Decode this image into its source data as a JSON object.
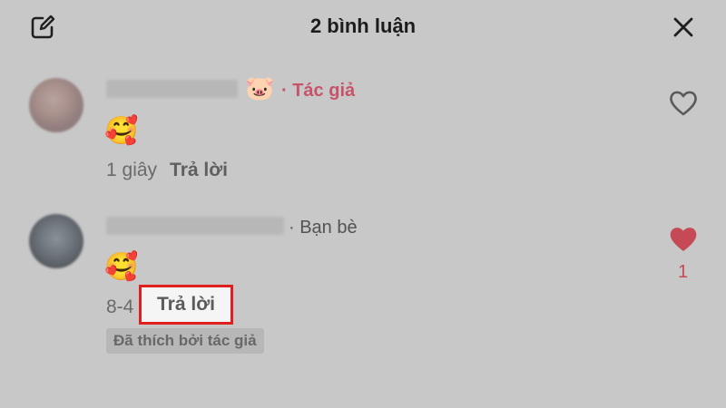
{
  "header": {
    "title": "2 bình luận",
    "edit_icon": "edit-icon",
    "close_icon": "close-icon"
  },
  "comments": [
    {
      "badge": "· Tác giả",
      "badge_color": "#c7536a",
      "username_emoji": "🐷",
      "content_emoji": "🥰",
      "time": "1 giây",
      "reply_label": "Trả lời",
      "liked": false
    },
    {
      "badge": "· Bạn bè",
      "content_emoji": "🥰",
      "time": "8-4",
      "reply_label": "Trả lời",
      "liked_by_author": "Đã thích bởi tác giả",
      "liked": true,
      "like_count": "1",
      "like_color": "#c54a55"
    }
  ],
  "highlight_color": "#e02020"
}
